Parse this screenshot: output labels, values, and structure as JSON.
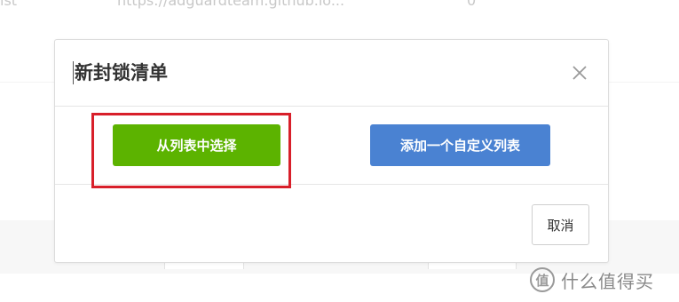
{
  "background": {
    "list_text": "ist",
    "url_text": "https://adguardteam.github.io...",
    "count_text": "0"
  },
  "modal": {
    "title": "新封锁清单",
    "close_icon": "close-icon",
    "choose_from_list_label": "从列表中选择",
    "add_custom_list_label": "添加一个自定义列表",
    "cancel_label": "取消"
  },
  "colors": {
    "green_button": "#5cb300",
    "blue_button": "#4a82d2",
    "highlight_border": "#d81f2a"
  },
  "watermark": {
    "text": "什么值得买",
    "logo_icon": "smzdm-logo-icon"
  }
}
